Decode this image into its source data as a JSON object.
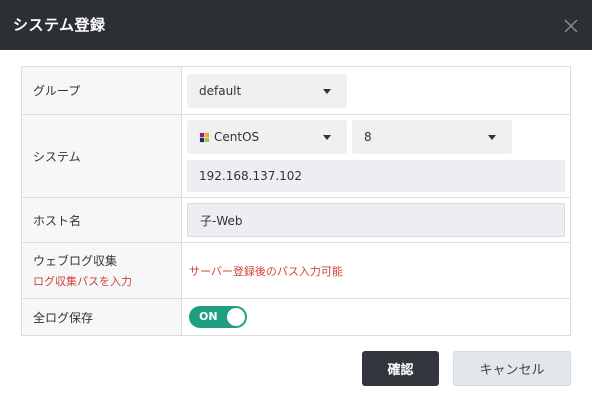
{
  "dialog": {
    "title": "システム登録"
  },
  "form": {
    "group": {
      "label": "グループ",
      "selected": "default"
    },
    "system": {
      "label": "システム",
      "os_selected": "CentOS",
      "version_selected": "8",
      "ip_value": "192.168.137.102"
    },
    "host": {
      "label": "ホスト名",
      "value": "子-Web"
    },
    "weblog": {
      "label": "ウェブログ収集",
      "sublabel": "ログ収集パスを入力",
      "notice": "サーバー登録後のパス入力可能"
    },
    "alllog": {
      "label": "全ログ保存",
      "toggle_text": "ON",
      "toggle_state": "on"
    }
  },
  "buttons": {
    "confirm": "確認",
    "cancel": "キャンセル"
  },
  "colors": {
    "header_bg": "#2c2f33",
    "accent_red": "#d0443c",
    "toggle_on": "#1e9e82",
    "confirm_bg": "#33373d"
  },
  "icons": {
    "close": "close-icon",
    "os_logo": "centos-logo-icon",
    "caret": "caret-down-icon"
  }
}
